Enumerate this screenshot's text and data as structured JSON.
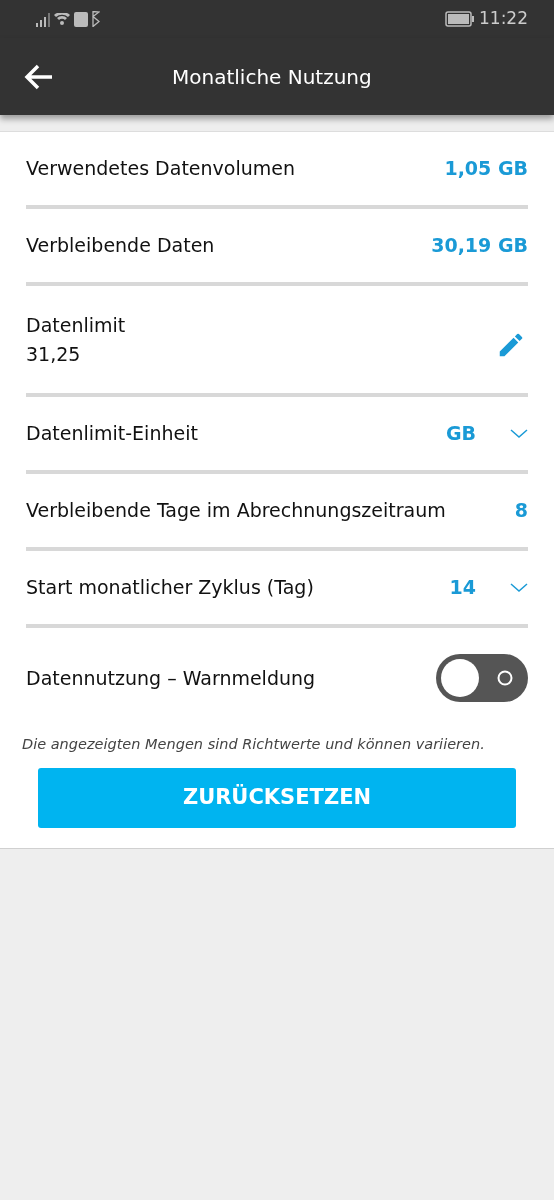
{
  "status_bar": {
    "time": "11:22"
  },
  "app_bar": {
    "title": "Monatliche Nutzung"
  },
  "rows": [
    {
      "kind": "value",
      "label": "Verwendetes Datenvolumen",
      "value": "1,05 GB"
    },
    {
      "kind": "value",
      "label": "Verbleibende Daten",
      "value": "30,19 GB"
    },
    {
      "kind": "edit",
      "label": "Datenlimit",
      "value": "31,25"
    },
    {
      "kind": "dropdown",
      "label": "Datenlimit-Einheit",
      "value": "GB"
    },
    {
      "kind": "value",
      "label": "Verbleibende Tage im Abrechnungszeitraum",
      "value": "8"
    },
    {
      "kind": "dropdown",
      "label": "Start monatlicher Zyklus (Tag)",
      "value": "14"
    }
  ],
  "warning": {
    "label": "Datennutzung – Warnmeldung",
    "on": false
  },
  "note": "Die angezeigten Mengen sind Richtwerte und können variieren.",
  "reset_button": "ZURÜCKSETZEN"
}
